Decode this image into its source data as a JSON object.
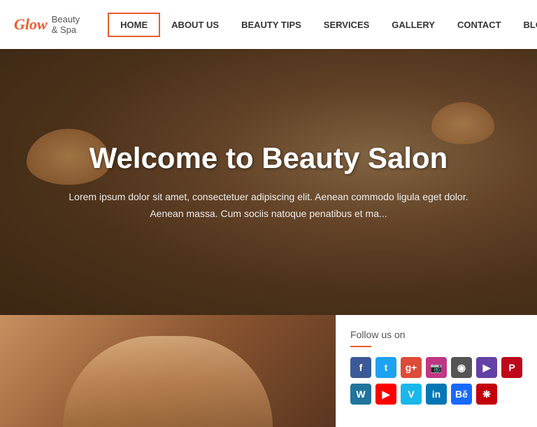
{
  "header": {
    "logo_glow": "Glow",
    "logo_subtitle": "Beauty & Spa",
    "nav": [
      {
        "label": "HOME",
        "active": true
      },
      {
        "label": "ABOUT US",
        "active": false
      },
      {
        "label": "BEAUTY TIPS",
        "active": false
      },
      {
        "label": "SERVICES",
        "active": false
      },
      {
        "label": "GALLERY",
        "active": false
      },
      {
        "label": "CONTACT",
        "active": false
      },
      {
        "label": "BLOG",
        "active": false
      }
    ]
  },
  "hero": {
    "title": "Welcome to Beauty Salon",
    "subtitle": "Lorem ipsum dolor sit amet, consectetuer adipiscing elit. Aenean commodo ligula eget dolor.\nAenean massa. Cum sociis natoque penatibus et ma..."
  },
  "bottom": {
    "follow_title": "Follow us on",
    "social_row1": [
      {
        "label": "f",
        "class": "si-facebook",
        "name": "facebook"
      },
      {
        "label": "t",
        "class": "si-twitter",
        "name": "twitter"
      },
      {
        "label": "g+",
        "class": "si-google",
        "name": "google-plus"
      },
      {
        "label": "📷",
        "class": "si-instagram",
        "name": "instagram"
      },
      {
        "label": "◉",
        "class": "si-circle",
        "name": "circle"
      },
      {
        "label": "▶",
        "class": "si-twitch",
        "name": "twitch"
      },
      {
        "label": "P",
        "class": "si-pinterest",
        "name": "pinterest"
      }
    ],
    "social_row2": [
      {
        "label": "W",
        "class": "si-wp",
        "name": "wordpress"
      },
      {
        "label": "▶",
        "class": "si-youtube",
        "name": "youtube"
      },
      {
        "label": "V",
        "class": "si-vimeo",
        "name": "vimeo"
      },
      {
        "label": "in",
        "class": "si-linkedin",
        "name": "linkedin"
      },
      {
        "label": "Bě",
        "class": "si-behance",
        "name": "behance"
      },
      {
        "label": "❋",
        "class": "si-last",
        "name": "lastfm"
      }
    ]
  }
}
